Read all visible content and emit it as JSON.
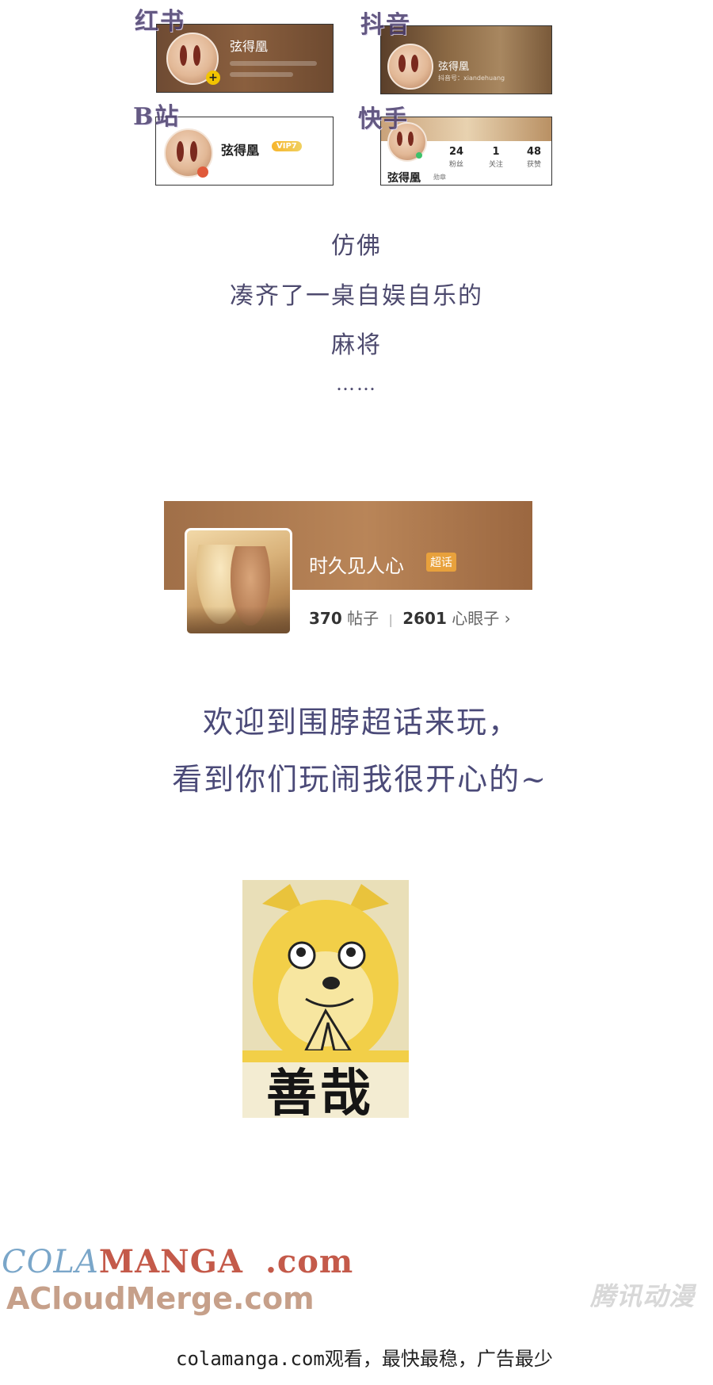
{
  "platforms": [
    {
      "label": "红书",
      "name": "弦得凰"
    },
    {
      "label": "抖音",
      "name": "弦得凰",
      "sub": "抖音号：xiandehuang"
    },
    {
      "label": "B站",
      "name": "弦得凰",
      "badge": "VIP7"
    },
    {
      "label": "快手",
      "name": "弦得凰",
      "sub": "勋章",
      "stats": [
        {
          "value": "24",
          "label": "粉丝"
        },
        {
          "value": "1",
          "label": "关注"
        },
        {
          "value": "48",
          "label": "获赞"
        }
      ]
    }
  ],
  "poem": [
    "仿佛",
    "凑齐了一桌自娱自乐的",
    "麻将",
    "……"
  ],
  "topic": {
    "title": "时久见人心",
    "badge": "超话",
    "posts_count": "370",
    "posts_label": "帖子",
    "separator": "|",
    "members_count": "2601",
    "members_label": "心眼子",
    "chevron": "›"
  },
  "welcome": [
    "欢迎到围脖超话来玩，",
    "看到你们玩闹我很开心的~"
  ],
  "meme": {
    "caption": "善哉",
    "icon": "doge-praying-icon"
  },
  "footer": {
    "watermark_part1": "COLA",
    "watermark_part2": "MANGA",
    "watermark_part3": ".com",
    "watermark_line2": "ACloudMerge.com",
    "publisher": "腾讯动漫",
    "note": "colamanga.com观看，最快最稳，广告最少"
  },
  "colors": {
    "text": "#4d4a6e",
    "accent": "#e8a13c",
    "wm_blue": "#7aa6c9",
    "wm_red": "#c45a4a",
    "wm_tan": "#c6a08a"
  }
}
